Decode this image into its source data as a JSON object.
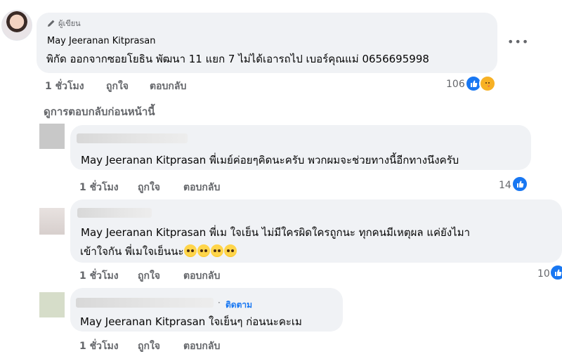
{
  "main_comment": {
    "badge": "ผู้เขียน",
    "author": "May Jeeranan Kitprasan",
    "text": "พิกัด ออกจากซอยโยธิน พัฒนา 11 แยก 7 ไม่ได้เอารถไป เบอร์คุณแม่ 0656695998",
    "time": "1 ชั่วโมง",
    "like_label": "ถูกใจ",
    "reply_label": "ตอบกลับ",
    "reaction_count": "106",
    "reaction_icons": [
      "like-icon",
      "care-icon"
    ]
  },
  "view_previous": "ดูการตอบกลับก่อนหน้านี้",
  "replies": [
    {
      "mention": "May Jeeranan Kitprasan",
      "text": " พี่เมย์ค่อยๆคิดนะครับ พวกผมจะช่วยทางนี้อีกทางนึงครับ",
      "time": "1 ชั่วโมง",
      "like_label": "ถูกใจ",
      "reply_label": "ตอบกลับ",
      "reaction_count": "14"
    },
    {
      "mention": "May Jeeranan Kitprasan",
      "text_line1": " พี่เม ใจเย็น ไม่มีใครผิดใครถูกนะ ทุกคนมีเหตุผล แค่ยังไมา",
      "text_line2": "เข้าใจกัน พี่เมใจเย็นนะ",
      "emoji_count": 4,
      "time": "1 ชั่วโมง",
      "like_label": "ถูกใจ",
      "reply_label": "ตอบกลับ",
      "reaction_count": "10"
    },
    {
      "follow_label": "ติดตาม",
      "mention": "May Jeeranan Kitprasan",
      "text": " ใจเย็นๆ ก่อนนะคะเม",
      "time": "1 ชั่วโมง",
      "like_label": "ถูกใจ",
      "reply_label": "ตอบกลับ"
    }
  ],
  "colors": {
    "bubble": "#f0f2f5",
    "secondary_text": "#65676b",
    "like_blue": "#1877f2",
    "care_yellow": "#f7b125"
  }
}
